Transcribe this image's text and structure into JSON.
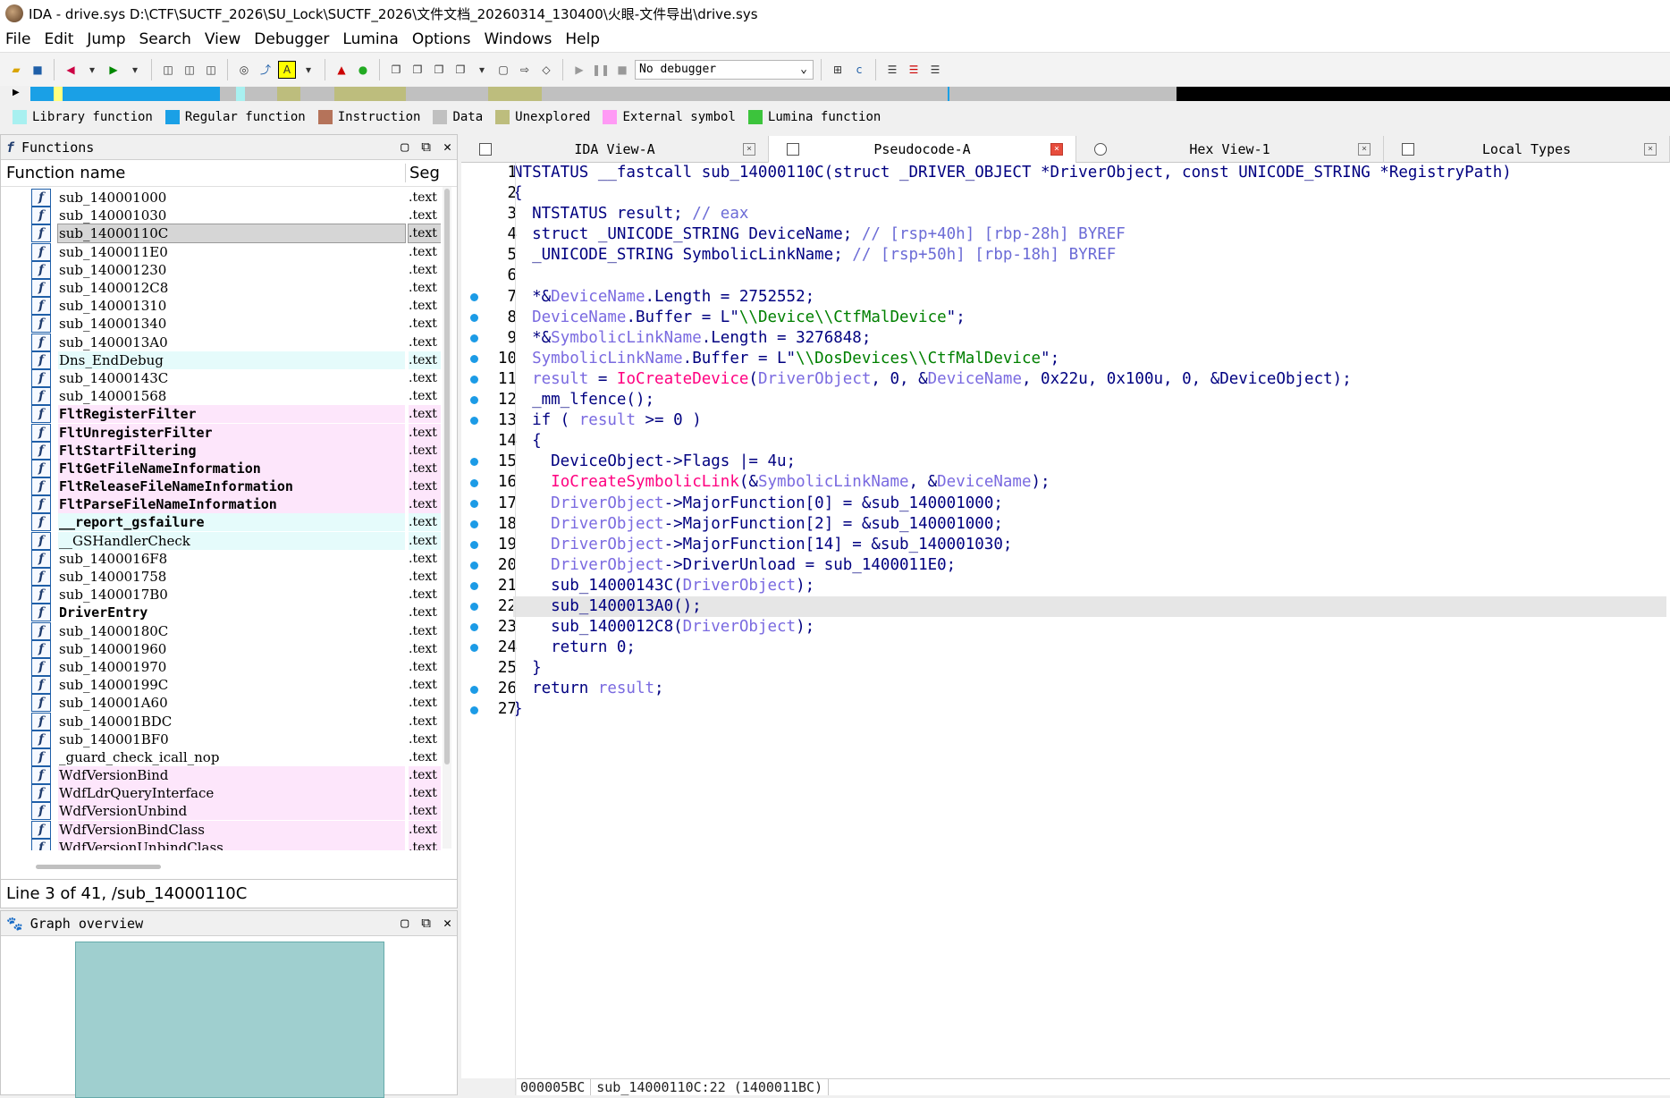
{
  "window": {
    "title": "IDA - drive.sys D:\\CTF\\SUCTF_2026\\SU_Lock\\SUCTF_2026\\文件文档_20260314_130400\\火眼-文件导出\\drive.sys"
  },
  "menu": [
    "File",
    "Edit",
    "Jump",
    "Search",
    "View",
    "Debugger",
    "Lumina",
    "Options",
    "Windows",
    "Help"
  ],
  "toolbar": {
    "debugger_select": "No debugger"
  },
  "legend": [
    {
      "label": "Library function",
      "color": "#a8f0f0"
    },
    {
      "label": "Regular function",
      "color": "#1aa0e6"
    },
    {
      "label": "Instruction",
      "color": "#b5735a"
    },
    {
      "label": "Data",
      "color": "#c0c0c0"
    },
    {
      "label": "Unexplored",
      "color": "#bdbd7d"
    },
    {
      "label": "External symbol",
      "color": "#ff9af5"
    },
    {
      "label": "Lumina function",
      "color": "#3cc43c"
    }
  ],
  "functions_panel": {
    "title": "Functions",
    "col_name": "Function name",
    "col_seg": "Seg",
    "rows": [
      {
        "name": "sub_140001000",
        "seg": ".text",
        "kind": "regular"
      },
      {
        "name": "sub_140001030",
        "seg": ".text",
        "kind": "regular"
      },
      {
        "name": "sub_14000110C",
        "seg": ".text",
        "kind": "selected"
      },
      {
        "name": "sub_1400011E0",
        "seg": ".text",
        "kind": "regular"
      },
      {
        "name": "sub_140001230",
        "seg": ".text",
        "kind": "regular"
      },
      {
        "name": "sub_1400012C8",
        "seg": ".text",
        "kind": "regular"
      },
      {
        "name": "sub_140001310",
        "seg": ".text",
        "kind": "regular"
      },
      {
        "name": "sub_140001340",
        "seg": ".text",
        "kind": "regular"
      },
      {
        "name": "sub_1400013A0",
        "seg": ".text",
        "kind": "regular"
      },
      {
        "name": "Dns_EndDebug",
        "seg": ".text",
        "kind": "lib"
      },
      {
        "name": "sub_14000143C",
        "seg": ".text",
        "kind": "regular"
      },
      {
        "name": "sub_140001568",
        "seg": ".text",
        "kind": "regular"
      },
      {
        "name": "FltRegisterFilter",
        "seg": ".text",
        "kind": "ext-bold"
      },
      {
        "name": "FltUnregisterFilter",
        "seg": ".text",
        "kind": "ext-bold"
      },
      {
        "name": "FltStartFiltering",
        "seg": ".text",
        "kind": "ext-bold"
      },
      {
        "name": "FltGetFileNameInformation",
        "seg": ".text",
        "kind": "ext-bold"
      },
      {
        "name": "FltReleaseFileNameInformation",
        "seg": ".text",
        "kind": "ext-bold"
      },
      {
        "name": "FltParseFileNameInformation",
        "seg": ".text",
        "kind": "ext-bold"
      },
      {
        "name": "__report_gsfailure",
        "seg": ".text",
        "kind": "lib-bold"
      },
      {
        "name": "__GSHandlerCheck",
        "seg": ".text",
        "kind": "lib"
      },
      {
        "name": "sub_1400016F8",
        "seg": ".text",
        "kind": "regular"
      },
      {
        "name": "sub_140001758",
        "seg": ".text",
        "kind": "regular"
      },
      {
        "name": "sub_1400017B0",
        "seg": ".text",
        "kind": "regular"
      },
      {
        "name": "DriverEntry",
        "seg": ".text",
        "kind": "bold"
      },
      {
        "name": "sub_14000180C",
        "seg": ".text",
        "kind": "regular"
      },
      {
        "name": "sub_140001960",
        "seg": ".text",
        "kind": "regular"
      },
      {
        "name": "sub_140001970",
        "seg": ".text",
        "kind": "regular"
      },
      {
        "name": "sub_14000199C",
        "seg": ".text",
        "kind": "regular"
      },
      {
        "name": "sub_140001A60",
        "seg": ".text",
        "kind": "regular"
      },
      {
        "name": "sub_140001BDC",
        "seg": ".text",
        "kind": "regular"
      },
      {
        "name": "sub_140001BF0",
        "seg": ".text",
        "kind": "regular"
      },
      {
        "name": "_guard_check_icall_nop",
        "seg": ".text",
        "kind": "regular"
      },
      {
        "name": "WdfVersionBind",
        "seg": ".text",
        "kind": "ext"
      },
      {
        "name": "WdfLdrQueryInterface",
        "seg": ".text",
        "kind": "ext"
      },
      {
        "name": "WdfVersionUnbind",
        "seg": ".text",
        "kind": "ext"
      },
      {
        "name": "WdfVersionBindClass",
        "seg": ".text",
        "kind": "ext"
      },
      {
        "name": "WdfVersionUnbindClass",
        "seg": ".text",
        "kind": "ext"
      }
    ],
    "status": "Line 3 of 41, /sub_14000110C"
  },
  "graph_panel": {
    "title": "Graph overview"
  },
  "tabs": [
    {
      "label": "IDA View-A",
      "active": false
    },
    {
      "label": "Pseudocode-A",
      "active": true
    },
    {
      "label": "Hex View-1",
      "active": false
    },
    {
      "label": "Local Types",
      "active": false
    }
  ],
  "code": {
    "lines": [
      {
        "n": "1",
        "dot": false,
        "hl": false,
        "text": "NTSTATUS __fastcall sub_14000110C(struct _DRIVER_OBJECT *DriverObject, const UNICODE_STRING *RegistryPath)"
      },
      {
        "n": "2",
        "dot": false,
        "hl": false,
        "text": "{"
      },
      {
        "n": "3",
        "dot": false,
        "hl": false,
        "text": "  NTSTATUS result; // eax"
      },
      {
        "n": "4",
        "dot": false,
        "hl": false,
        "text": "  struct _UNICODE_STRING DeviceName; // [rsp+40h] [rbp-28h] BYREF"
      },
      {
        "n": "5",
        "dot": false,
        "hl": false,
        "text": "  _UNICODE_STRING SymbolicLinkName; // [rsp+50h] [rbp-18h] BYREF"
      },
      {
        "n": "6",
        "dot": false,
        "hl": false,
        "text": ""
      },
      {
        "n": "7",
        "dot": true,
        "hl": false,
        "text": "  *&DeviceName.Length = 2752552;"
      },
      {
        "n": "8",
        "dot": true,
        "hl": false,
        "text": "  DeviceName.Buffer = L\"\\\\Device\\\\CtfMalDevice\";"
      },
      {
        "n": "9",
        "dot": true,
        "hl": false,
        "text": "  *&SymbolicLinkName.Length = 3276848;"
      },
      {
        "n": "10",
        "dot": true,
        "hl": false,
        "text": "  SymbolicLinkName.Buffer = L\"\\\\DosDevices\\\\CtfMalDevice\";"
      },
      {
        "n": "11",
        "dot": true,
        "hl": false,
        "text": "  result = IoCreateDevice(DriverObject, 0, &DeviceName, 0x22u, 0x100u, 0, &DeviceObject);"
      },
      {
        "n": "12",
        "dot": true,
        "hl": false,
        "text": "  _mm_lfence();"
      },
      {
        "n": "13",
        "dot": true,
        "hl": false,
        "text": "  if ( result >= 0 )"
      },
      {
        "n": "14",
        "dot": false,
        "hl": false,
        "text": "  {"
      },
      {
        "n": "15",
        "dot": true,
        "hl": false,
        "text": "    DeviceObject->Flags |= 4u;"
      },
      {
        "n": "16",
        "dot": true,
        "hl": false,
        "text": "    IoCreateSymbolicLink(&SymbolicLinkName, &DeviceName);"
      },
      {
        "n": "17",
        "dot": true,
        "hl": false,
        "text": "    DriverObject->MajorFunction[0] = &sub_140001000;"
      },
      {
        "n": "18",
        "dot": true,
        "hl": false,
        "text": "    DriverObject->MajorFunction[2] = &sub_140001000;"
      },
      {
        "n": "19",
        "dot": true,
        "hl": false,
        "text": "    DriverObject->MajorFunction[14] = &sub_140001030;"
      },
      {
        "n": "20",
        "dot": true,
        "hl": false,
        "text": "    DriverObject->DriverUnload = sub_1400011E0;"
      },
      {
        "n": "21",
        "dot": true,
        "hl": false,
        "text": "    sub_14000143C(DriverObject);"
      },
      {
        "n": "22",
        "dot": true,
        "hl": true,
        "text": "    sub_1400013A0();"
      },
      {
        "n": "23",
        "dot": true,
        "hl": false,
        "text": "    sub_1400012C8(DriverObject);"
      },
      {
        "n": "24",
        "dot": true,
        "hl": false,
        "text": "    return 0;"
      },
      {
        "n": "25",
        "dot": false,
        "hl": false,
        "text": "  }"
      },
      {
        "n": "26",
        "dot": true,
        "hl": false,
        "text": "  return result;"
      },
      {
        "n": "27",
        "dot": true,
        "hl": false,
        "text": "}"
      }
    ],
    "status_offset": "000005BC",
    "status_loc": "sub_14000110C:22 (1400011BC)"
  }
}
